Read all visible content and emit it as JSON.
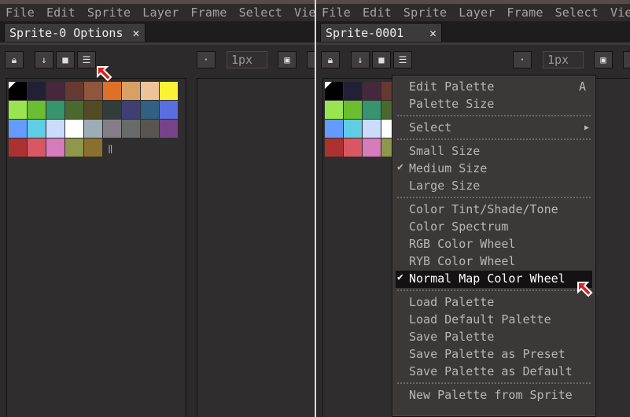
{
  "menubar": [
    "File",
    "Edit",
    "Sprite",
    "Layer",
    "Frame",
    "Select",
    "View"
  ],
  "left": {
    "tab": {
      "label": "Sprite-0 Options",
      "close": "✕"
    },
    "brush_size": "1px"
  },
  "right": {
    "tab": {
      "label": "Sprite-0001",
      "close": "✕"
    },
    "brush_size": "1px"
  },
  "palette_colors": [
    "#000000",
    "#222034",
    "#45283c",
    "#663931",
    "#8f563b",
    "#df7126",
    "#d9a066",
    "#eec39a",
    "#fbf236",
    "#99e550",
    "#6abe30",
    "#37946e",
    "#4b692f",
    "#524b24",
    "#323c39",
    "#3f3f74",
    "#306082",
    "#5b6ee1",
    "#639bff",
    "#5fcde4",
    "#cbdbfc",
    "#ffffff",
    "#9badb7",
    "#847e87",
    "#696a6a",
    "#595652",
    "#76428a",
    "#ac3232",
    "#d95763",
    "#d77bba",
    "#8f974a",
    "#8a6f30"
  ],
  "palette_menu": {
    "items": [
      {
        "label": "Edit Palette",
        "shortcut": "A"
      },
      {
        "label": "Palette Size"
      },
      {
        "label": "Select",
        "arrow": "▶"
      },
      {
        "label": "Small Size"
      },
      {
        "label": "Medium Size",
        "checked": "✔"
      },
      {
        "label": "Large Size"
      },
      {
        "label": "Color Tint/Shade/Tone"
      },
      {
        "label": "Color Spectrum"
      },
      {
        "label": "RGB Color Wheel"
      },
      {
        "label": "RYB Color Wheel"
      },
      {
        "label": "Normal Map Color Wheel",
        "checked": "✔",
        "highlighted": true
      },
      {
        "label": "Load Palette"
      },
      {
        "label": "Load Default Palette"
      },
      {
        "label": "Save Palette"
      },
      {
        "label": "Save Palette as Preset"
      },
      {
        "label": "Save Palette as Default"
      },
      {
        "label": "New Palette from Sprite"
      }
    ]
  }
}
